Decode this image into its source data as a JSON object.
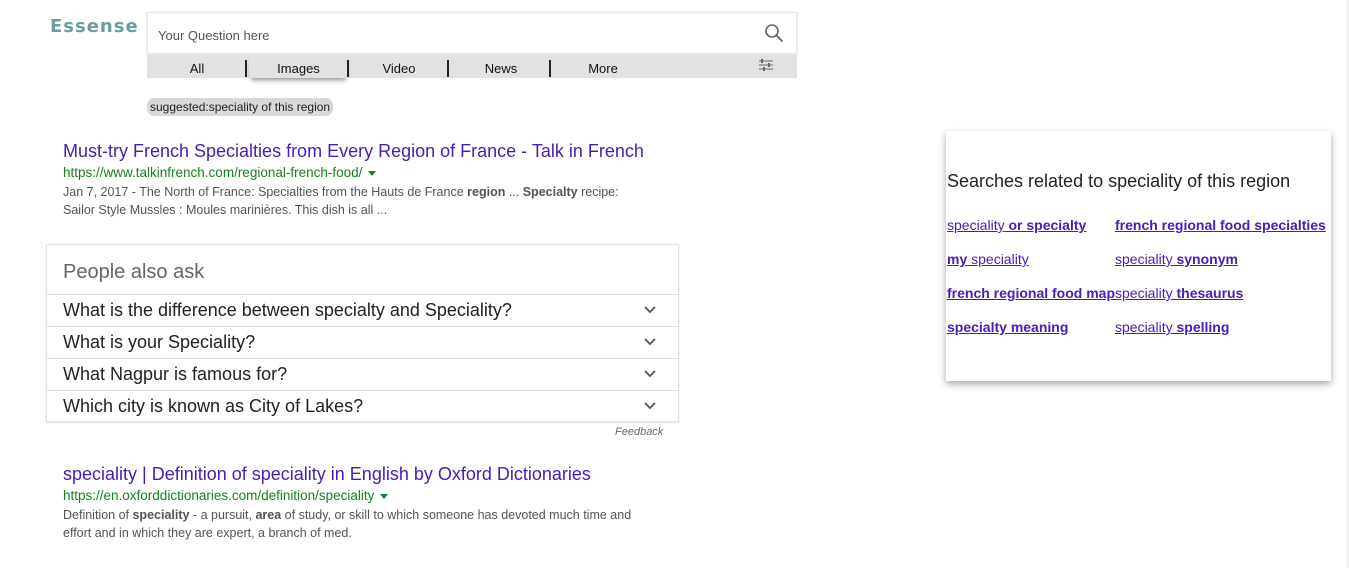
{
  "logo": "Essense",
  "search": {
    "placeholder": "Your Question here"
  },
  "tabs": [
    {
      "label": "All"
    },
    {
      "label": "Images"
    },
    {
      "label": "Video"
    },
    {
      "label": "News"
    },
    {
      "label": "More"
    }
  ],
  "suggested": "suggested:speciality of this region",
  "results": [
    {
      "title": "Must-try French Specialties from Every Region of France - Talk in French",
      "url": "https://www.talkinfrench.com/regional-french-food/",
      "snippet_line1_a": "Jan 7, 2017 - The North of France: Specialties from the Hauts de France ",
      "snippet_line1_b": "region",
      "snippet_line1_c": " ... ",
      "snippet_line1_d": "Specialty",
      "snippet_line1_e": " recipe:",
      "snippet_line2": "Sailor Style Mussles : Moules marinières. This dish is all ..."
    },
    {
      "title": "speciality | Definition of speciality in English by Oxford Dictionaries",
      "url": "https://en.oxforddictionaries.com/definition/speciality",
      "snippet_line1_a": "Definition of ",
      "snippet_line1_b": "speciality",
      "snippet_line1_c": " - a pursuit, ",
      "snippet_line1_d": "area",
      "snippet_line1_e": " of study, or skill to which someone has devoted much time and",
      "snippet_line2": "effort and in which they are expert, a branch of med."
    }
  ],
  "people_also_ask": {
    "heading": "People also ask",
    "questions": [
      "What is the difference between specialty and Speciality?",
      "What is your Speciality?",
      "What Nagpur is famous for?",
      "Which city is known as City of Lakes?"
    ],
    "feedback": "Feedback"
  },
  "related": {
    "title": "Searches related to speciality of this region",
    "links": [
      {
        "plain": "speciality",
        "bold": " or specialty"
      },
      {
        "plain": "",
        "bold": "french regional food specialties"
      },
      {
        "plain": " speciality",
        "bold": "my"
      },
      {
        "plain": "speciality",
        "bold": " synonym"
      },
      {
        "plain": "",
        "bold": "french regional food map"
      },
      {
        "plain": "speciality",
        "bold": " thesaurus"
      },
      {
        "plain": "",
        "bold": "specialty meaning"
      },
      {
        "plain": "speciality",
        "bold": " spelling"
      }
    ]
  },
  "colors": {
    "link": "#4b1bb5",
    "url": "#16801d",
    "logo": "#6a9e9e"
  }
}
